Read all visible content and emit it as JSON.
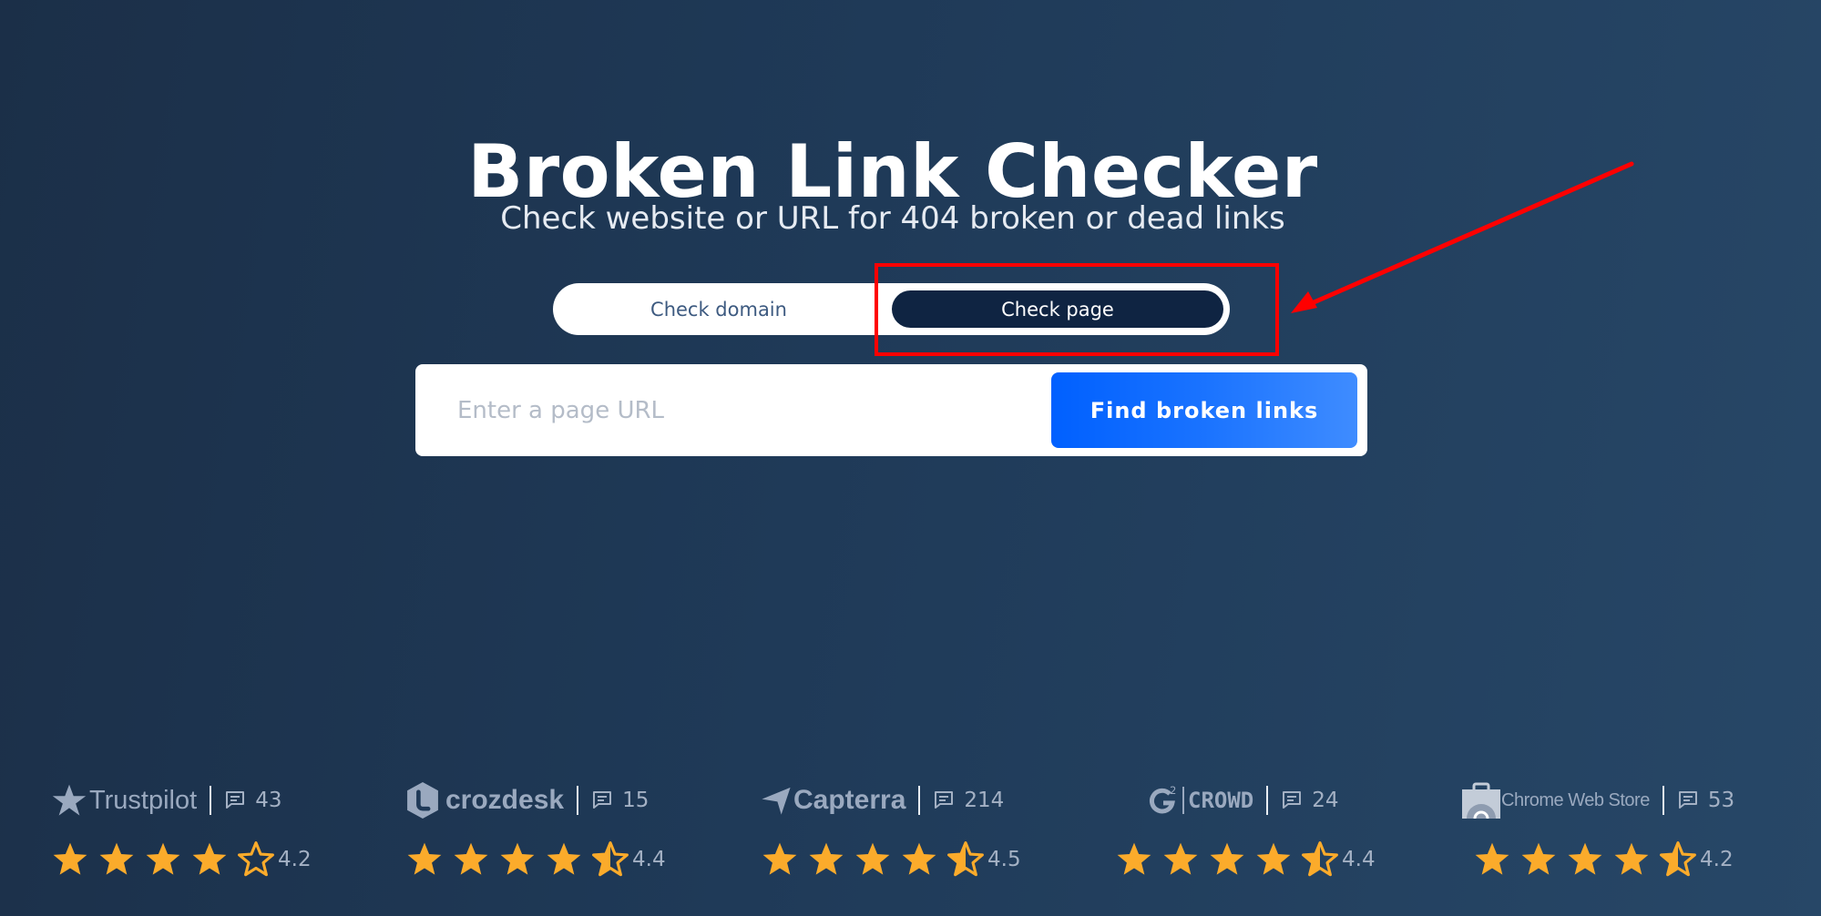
{
  "header": {
    "title": "Broken Link Checker",
    "subtitle": "Check website or URL for 404 broken or dead links"
  },
  "mode_toggle": {
    "options": [
      {
        "label": "Check domain",
        "active": false
      },
      {
        "label": "Check page",
        "active": true
      }
    ]
  },
  "search": {
    "placeholder": "Enter a page URL",
    "value": "",
    "button_label": "Find broken links"
  },
  "colors": {
    "accent_blue": "#0060ff",
    "active_tab": "#0f2442",
    "star": "#fbab2b",
    "annotation": "#ff0000"
  },
  "reviews": [
    {
      "platform": "Trustpilot",
      "icon": "trustpilot-star-icon",
      "count": "43",
      "rating": "4.2",
      "stars_filled": 4,
      "last_star": "empty"
    },
    {
      "platform": "crozdesk",
      "icon": "crozdesk-logo-icon",
      "count": "15",
      "rating": "4.4",
      "stars_filled": 4,
      "last_star": "half"
    },
    {
      "platform": "Capterra",
      "icon": "capterra-arrow-icon",
      "count": "214",
      "rating": "4.5",
      "stars_filled": 4,
      "last_star": "half"
    },
    {
      "platform": "CROWD",
      "icon": "g2-logo-icon",
      "count": "24",
      "rating": "4.4",
      "stars_filled": 4,
      "last_star": "half"
    },
    {
      "platform": "Chrome Web Store",
      "icon": "chrome-web-store-icon",
      "count": "53",
      "rating": "4.2",
      "stars_filled": 4,
      "last_star": "half"
    }
  ]
}
